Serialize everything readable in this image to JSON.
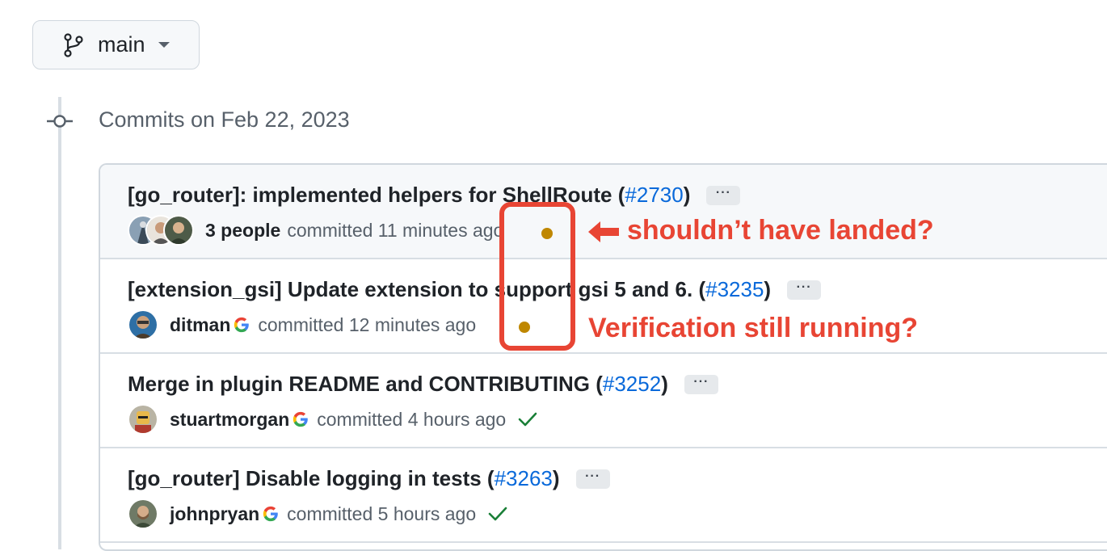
{
  "branch": {
    "name": "main"
  },
  "commit_group": {
    "heading": "Commits on Feb 22, 2023"
  },
  "commits": [
    {
      "title": "[go_router]: implemented helpers for ShellRoute (",
      "pr": "#2730",
      "title_suffix": ")",
      "more_label": "···",
      "author": "3 people",
      "action": "committed 11 minutes ago",
      "status": "pending"
    },
    {
      "title": "[extension_gsi] Update extension to support gsi 5 and 6. (",
      "pr": "#3235",
      "title_suffix": ")",
      "more_label": "···",
      "author": "ditman",
      "action": "committed 12 minutes ago",
      "status": "pending"
    },
    {
      "title": "Merge in plugin README and CONTRIBUTING (",
      "pr": "#3252",
      "title_suffix": ")",
      "more_label": "···",
      "author": "stuartmorgan",
      "action": "committed 4 hours ago",
      "status": "success"
    },
    {
      "title": "[go_router] Disable logging in tests (",
      "pr": "#3263",
      "title_suffix": ")",
      "more_label": "···",
      "author": "johnpryan",
      "action": "committed 5 hours ago",
      "status": "success"
    }
  ],
  "annotations": {
    "first": "shouldn’t have landed?",
    "second": "Verification still running?"
  },
  "colors": {
    "pending": "#bf8700",
    "success": "#1a7f37",
    "annotation": "#e84534",
    "link": "#0969da"
  }
}
